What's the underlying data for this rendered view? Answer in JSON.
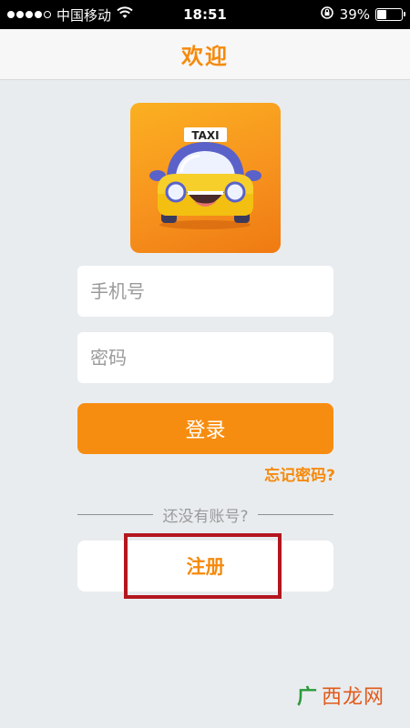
{
  "status_bar": {
    "carrier": "中国移动",
    "time": "18:51",
    "battery": "39%",
    "battery_level": 0.39,
    "wifi_icon": "wifi-icon",
    "lock_icon": "rotation-lock-icon"
  },
  "nav": {
    "title": "欢迎"
  },
  "logo": {
    "sign_text": "TAXI"
  },
  "form": {
    "phone_placeholder": "手机号",
    "password_placeholder": "密码",
    "login_label": "登录",
    "forgot_label": "忘记密码?"
  },
  "divider": {
    "text": "还没有账号?"
  },
  "register": {
    "label": "注册"
  },
  "watermark": {
    "text": "西龙网"
  },
  "colors": {
    "accent": "#f78d10",
    "highlight": "#b3161f",
    "background": "#e9ecef"
  }
}
